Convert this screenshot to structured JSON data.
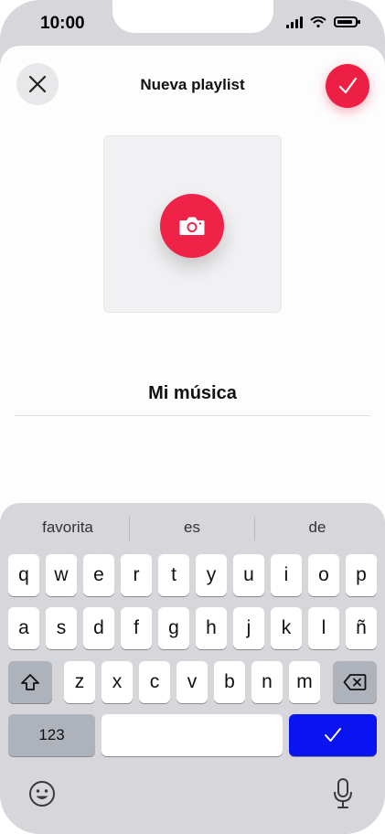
{
  "status": {
    "time": "10:00"
  },
  "header": {
    "title": "Nueva playlist"
  },
  "playlist": {
    "name": "Mi música"
  },
  "keyboard": {
    "suggestions": [
      "favorita",
      "es",
      "de"
    ],
    "row1": [
      "q",
      "w",
      "e",
      "r",
      "t",
      "y",
      "u",
      "i",
      "o",
      "p"
    ],
    "row2": [
      "a",
      "s",
      "d",
      "f",
      "g",
      "h",
      "j",
      "k",
      "l",
      "ñ"
    ],
    "row3": [
      "z",
      "x",
      "c",
      "v",
      "b",
      "n",
      "m"
    ],
    "numbers_label": "123"
  },
  "colors": {
    "accent": "#ee1f44",
    "keyboard_bg": "#d6d6db",
    "return_key": "#0a14f0"
  }
}
